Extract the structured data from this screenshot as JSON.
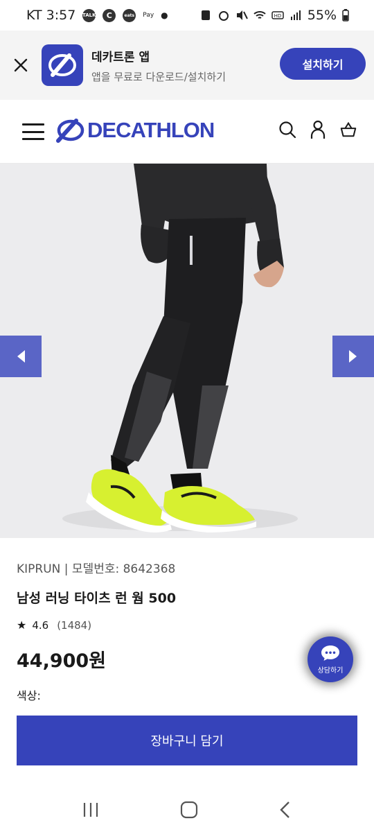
{
  "status_bar": {
    "carrier_time": "KT 3:57",
    "talk": "TALK",
    "c": "C",
    "eats_label": "coupang\neats",
    "pay": "Pay",
    "battery": "55%"
  },
  "app_banner": {
    "title": "데카트론 앱",
    "subtitle": "앱을 무료로 다운로드/설치하기",
    "install_label": "설치하기"
  },
  "header": {
    "brand": "DECATHLON"
  },
  "product": {
    "model_line": "KIPRUN | 모델번호: 8642368",
    "name": "남성 러닝 타이츠 런 웜 500",
    "rating_value": "4.6",
    "rating_count": "(1484)",
    "price": "44,900원",
    "color_label": "색상:"
  },
  "cart": {
    "label": "장바구니 담기"
  },
  "chat": {
    "label": "상담하기"
  },
  "colors": {
    "brand_blue": "#3643ba",
    "arrow_blue": "#5a65c6",
    "shoe_yellow": "#d7f030"
  }
}
